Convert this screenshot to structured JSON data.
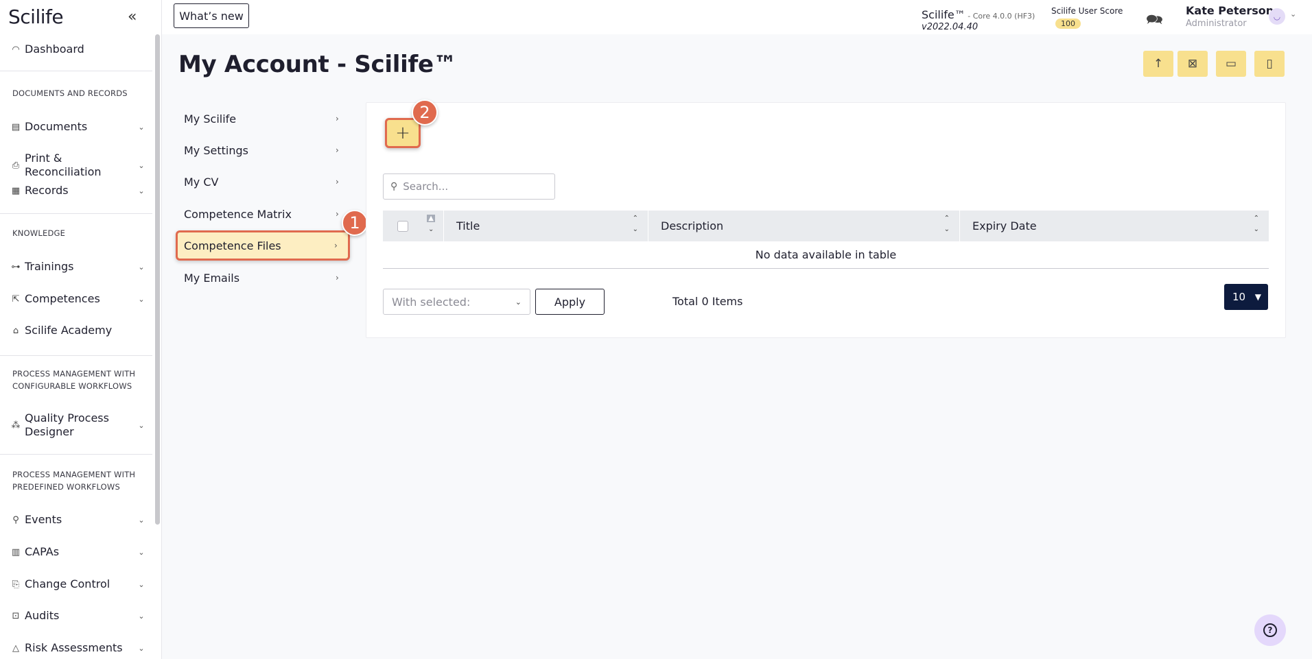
{
  "app": {
    "logo": "Scilife"
  },
  "sidebar": {
    "dashboard": "Dashboard",
    "sections": {
      "documents": "DOCUMENTS AND RECORDS",
      "knowledge": "KNOWLEDGE",
      "process_config_1": "PROCESS MANAGEMENT WITH",
      "process_config_2": "CONFIGURABLE WORKFLOWS",
      "process_pre_1": "PROCESS MANAGEMENT WITH",
      "process_pre_2": "PREDEFINED WORKFLOWS"
    },
    "items": {
      "documents": "Documents",
      "print": "Print & Reconciliation",
      "records": "Records",
      "trainings": "Trainings",
      "competences": "Competences",
      "academy": "Scilife Academy",
      "qpd_1": "Quality Process",
      "qpd_2": "Designer",
      "events": "Events",
      "capas": "CAPAs",
      "change": "Change Control",
      "audits": "Audits",
      "risk": "Risk Assessments"
    }
  },
  "topbar": {
    "whats_new": "What’s new",
    "product": "Scilife™",
    "core": " - Core 4.0.0 (HF3)",
    "build": "v2022.04.40",
    "score_label": "Scilife User Score",
    "score_value": "100",
    "user_name": "Kate Peterson",
    "user_role": "Administrator"
  },
  "page": {
    "title": "My Account - Scilife™"
  },
  "menu": {
    "my_scilife": "My Scilife",
    "my_settings": "My Settings",
    "my_cv": "My CV",
    "competence_matrix": "Competence Matrix",
    "competence_files": "Competence Files",
    "my_emails": "My Emails"
  },
  "steps": {
    "one": "1",
    "two": "2"
  },
  "table": {
    "search_placeholder": "Search...",
    "columns": [
      "Title",
      "Description",
      "Expiry Date"
    ],
    "empty": "No data available in table",
    "with_selected": "With selected:",
    "apply": "Apply",
    "total": "Total 0 Items",
    "page_size": "10"
  },
  "colors": {
    "accent_yellow": "#f8e08e",
    "highlight": "#e06a4e",
    "navy": "#0d1b3e"
  }
}
